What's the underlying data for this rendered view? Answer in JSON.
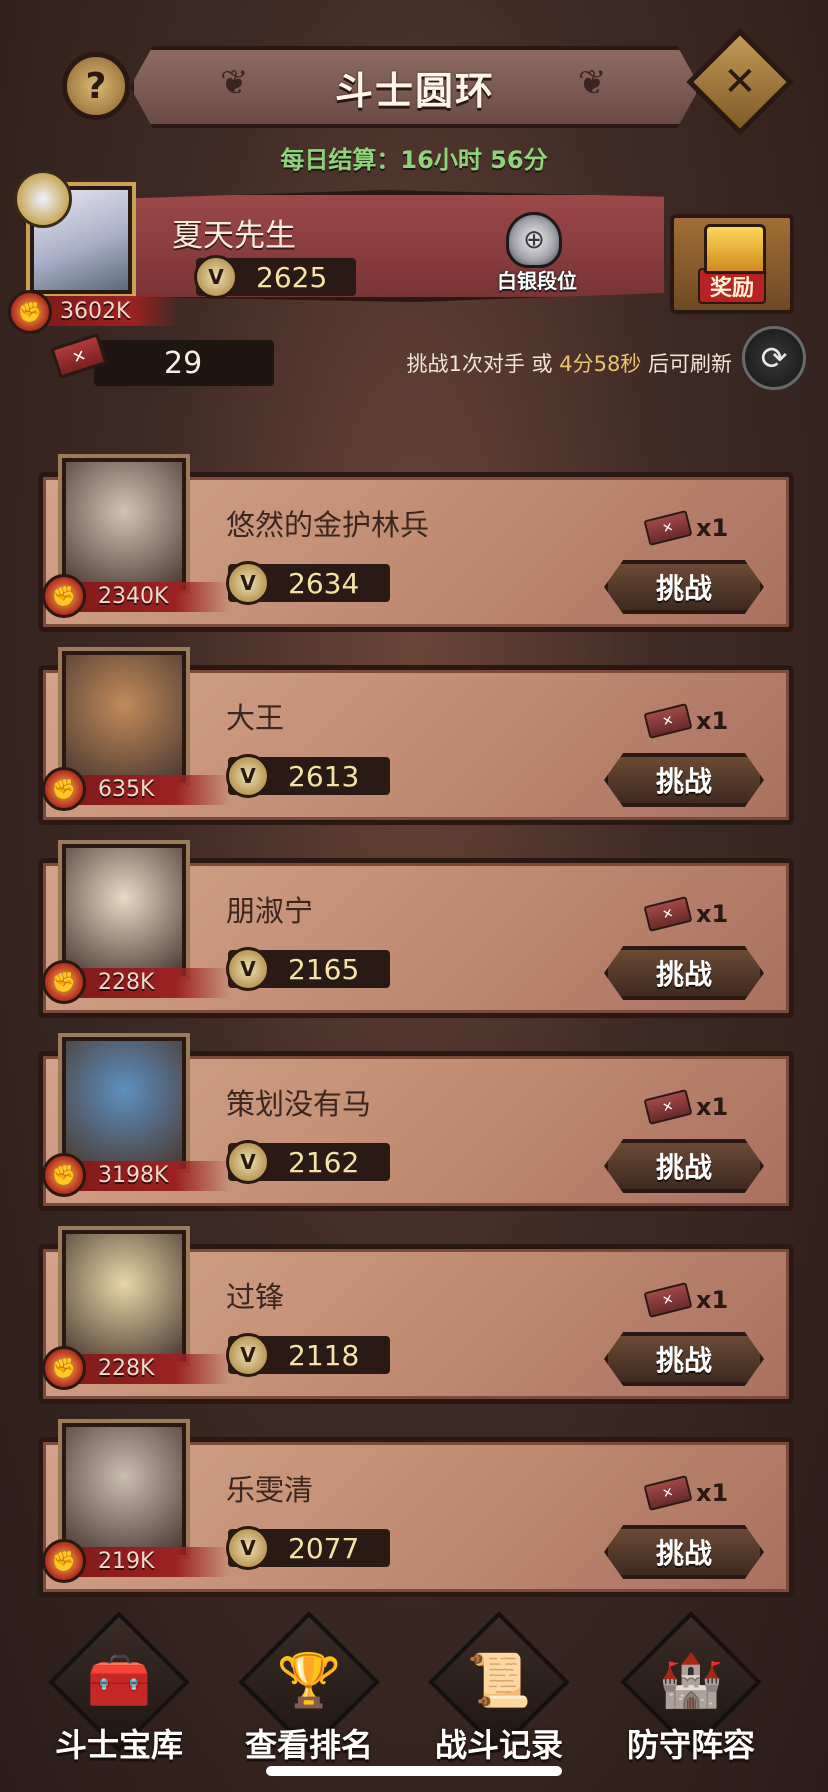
{
  "header": {
    "title": "斗士圆环",
    "help_symbol": "?",
    "close_symbol": "✕"
  },
  "settlement": {
    "label": "每日结算：16小时 56分"
  },
  "player": {
    "name": "夏天先生",
    "score": "2625",
    "power": "3602K",
    "rank_label": "白银段位",
    "reward_label": "奖励",
    "tickets": "29"
  },
  "refresh": {
    "prefix": "挑战1次对手 或 ",
    "time": "4分58秒",
    "suffix": " 后可刷新"
  },
  "opponents": [
    {
      "name": "悠然的金护林兵",
      "score": "2634",
      "power": "2340K",
      "cost": "x1",
      "button": "挑战",
      "portrait_color": "#cfc4b4"
    },
    {
      "name": "大王",
      "score": "2613",
      "power": "635K",
      "cost": "x1",
      "button": "挑战",
      "portrait_color": "#c28a5a"
    },
    {
      "name": "朋淑宁",
      "score": "2165",
      "power": "228K",
      "cost": "x1",
      "button": "挑战",
      "portrait_color": "#e8d8c4"
    },
    {
      "name": "策划没有马",
      "score": "2162",
      "power": "3198K",
      "cost": "x1",
      "button": "挑战",
      "portrait_color": "#5e8fbf"
    },
    {
      "name": "过锋",
      "score": "2118",
      "power": "228K",
      "cost": "x1",
      "button": "挑战",
      "portrait_color": "#e8d6a8"
    },
    {
      "name": "乐雯清",
      "score": "2077",
      "power": "219K",
      "cost": "x1",
      "button": "挑战",
      "portrait_color": "#c8beb0"
    }
  ],
  "nav": [
    {
      "label": "斗士宝库",
      "icon": "treasure-chest-icon",
      "glyph": "🧰"
    },
    {
      "label": "查看排名",
      "icon": "trophy-cup-icon",
      "glyph": "🏆"
    },
    {
      "label": "战斗记录",
      "icon": "battle-scroll-icon",
      "glyph": "📜"
    },
    {
      "label": "防守阵容",
      "icon": "defense-tower-icon",
      "glyph": "🏰"
    }
  ]
}
